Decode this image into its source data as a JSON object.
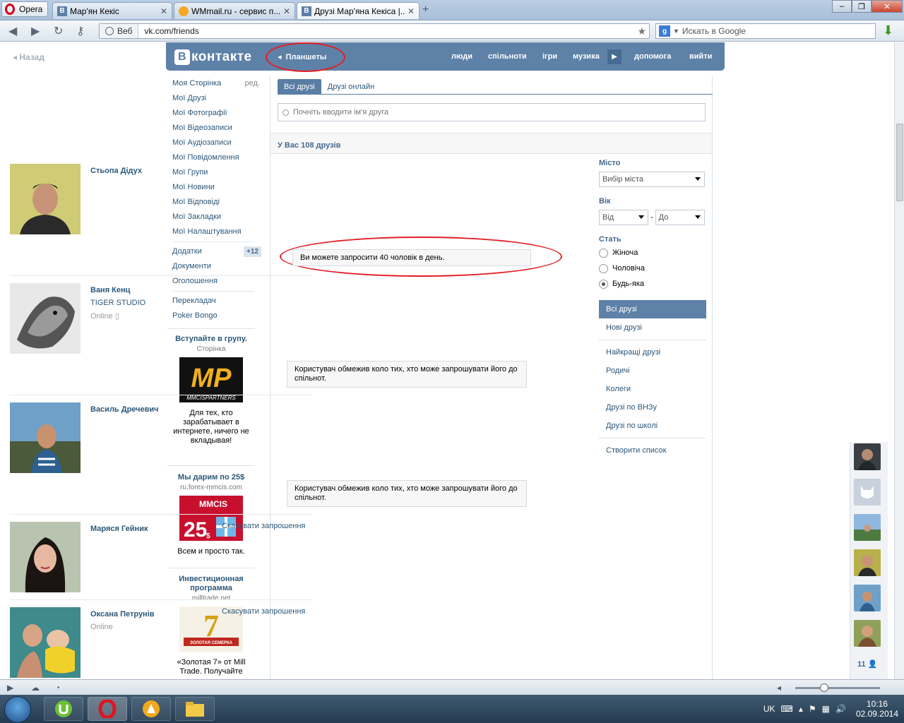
{
  "browser": {
    "opera_label": "Opera",
    "tabs": [
      {
        "label": "Мар'ян Кекіс"
      },
      {
        "label": "WMmail.ru - сервис п..."
      },
      {
        "label": "Друзі Мар'яна Кекіса |..."
      }
    ],
    "web_chip": "Веб",
    "url": "vk.com/friends",
    "search_placeholder": "Искать в Google"
  },
  "page": {
    "back": "Назад",
    "header": {
      "logo": "контакте",
      "logo_letter": "В",
      "tablets": "Планшеты",
      "nav": [
        "люди",
        "спільноти",
        "ігри",
        "музика",
        "допомога",
        "вийти"
      ]
    },
    "left_nav": {
      "items": [
        "Моя Сторінка",
        "Мої Друзі",
        "Мої Фотографії",
        "Мої Відеозаписи",
        "Мої Аудіозаписи",
        "Мої Повідомлення",
        "Мої Групи",
        "Мої Новини",
        "Мої Відповіді",
        "Мої Закладки",
        "Мої Налаштування"
      ],
      "edit": "ред.",
      "secondary": [
        "Додатки",
        "Документи",
        "Оголошення"
      ],
      "apps_badge": "+12",
      "tertiary": [
        "Перекладач",
        "Poker Bongo"
      ]
    },
    "ads": [
      {
        "title": "Вступайте в групу.",
        "sub": "Сторінка",
        "text": "Для тех, кто зарабатывает в интернете, ничего не вкладывая!",
        "img_label": "MP",
        "img_caption": "MMCISPARTNERS"
      },
      {
        "title": "Мы дарим по 25$",
        "sub": "ru.forex-mmcis.com",
        "text": "Всем и просто так.",
        "img_label": "MMCIS",
        "img_number": "25",
        "img_currency": "$"
      },
      {
        "title": "Инвестиционная программа",
        "sub": "milltrade.net",
        "text": "«Золотая 7» от Mill Trade. Получайте",
        "img_number": "7",
        "img_caption": "ЗОЛОТАЯ СЕМЕРКА"
      }
    ],
    "tabs": [
      "Всі друзі",
      "Друзі онлайн"
    ],
    "search_placeholder": "Почніть вводити ім'я друга",
    "count_text": "У Вас 108 друзів",
    "friends": [
      {
        "name": "Стьопа Дідух",
        "sub": "",
        "online": "",
        "notice": "Ви можете запросити 40 чоловік в день.",
        "cancel": ""
      },
      {
        "name": "Ваня Кенц",
        "sub": "TIGER STUDIO",
        "online": "Online",
        "notice": "Користувач обмежив коло тих, хто може запрошувати його до спільнот.",
        "cancel": ""
      },
      {
        "name": "Василь Дречевич",
        "sub": "",
        "online": "",
        "notice": "Користувач обмежив коло тих, хто може запрошувати його до спільнот.",
        "cancel": ""
      },
      {
        "name": "Маряся Гейник",
        "sub": "",
        "online": "",
        "notice": "",
        "cancel": "Скасувати запрошення"
      },
      {
        "name": "Оксана Петрунів",
        "sub": "",
        "online": "Online",
        "notice": "",
        "cancel": "Скасувати запрошення"
      }
    ],
    "filters": {
      "city_label": "Місто",
      "city_select": "Вибір міста",
      "age_label": "Вік",
      "age_from": "Від",
      "age_dash": "-",
      "age_to": "До",
      "gender_label": "Стать",
      "gender_options": [
        "Жіноча",
        "Чоловіча",
        "Будь-яка"
      ],
      "gender_selected": "Будь-яка",
      "menu": [
        "Всі друзі",
        "Нові друзі",
        "Найкращі друзі",
        "Родичі",
        "Колеги",
        "Друзі по ВНЗу",
        "Друзі по школі",
        "Створити список"
      ]
    },
    "chat_count": "11"
  },
  "taskbar": {
    "lang": "UK",
    "time": "10:16",
    "date": "02.09.2014"
  },
  "colors": {
    "vk_blue": "#5e81a8",
    "link": "#2b587a",
    "annotation_red": "#e41e26"
  }
}
